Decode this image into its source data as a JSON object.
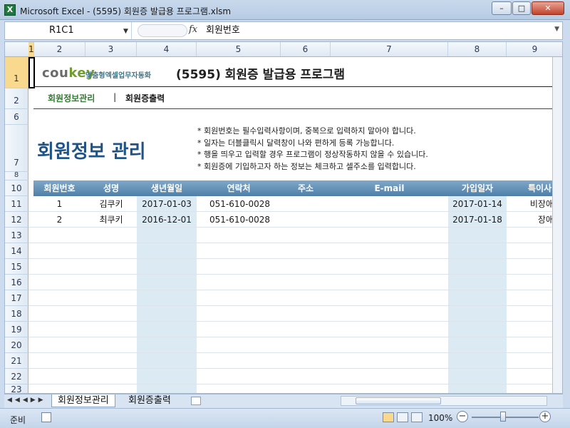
{
  "window": {
    "title": "Microsoft Excel - (5595) 회원증 발급용 프로그램.xlsm",
    "minimize": "–",
    "maximize": "□",
    "close": "✕"
  },
  "formula": {
    "namebox": "R1C1",
    "fx": "fx",
    "content": "회원번호"
  },
  "columns": [
    "1",
    "2",
    "3",
    "4",
    "5",
    "6",
    "7",
    "8",
    "9"
  ],
  "rows": [
    "1",
    "2",
    "6",
    "7",
    "8",
    "10",
    "11",
    "12",
    "13",
    "14",
    "15",
    "16",
    "17",
    "18",
    "19",
    "20",
    "21",
    "22",
    "23"
  ],
  "header": {
    "logo_main": "cou",
    "logo_accent": "key",
    "logo_sub": "맞춤형엑셀업무자동화",
    "program_title": "(5595) 회원증 발급용 프로그램"
  },
  "nav": {
    "active": "회원정보관리",
    "separator": "|",
    "other": "회원증출력"
  },
  "page_title": "회원정보 관리",
  "notes": [
    "* 회원번호는 필수입력사항이며, 중복으로 입력하지 말아야 합니다.",
    "* 일자는 더블클릭시 달력창이 나와 편하게 등록 가능합니다.",
    "* 행을 띄우고 입력할 경우 프로그램이 정상작동하지 않을 수 있습니다.",
    "* 회원증에 기입하고자 하는 정보는 체크하고 셀주소를 입력합니다."
  ],
  "table": {
    "headers": [
      "회원번호",
      "성명",
      "생년월일",
      "연락처",
      "주소",
      "E-mail",
      "가입일자",
      "특이사"
    ],
    "rows": [
      [
        "1",
        "김쿠키",
        "2017-01-03",
        "051-610-0028",
        "",
        "",
        "2017-01-14",
        "비장애"
      ],
      [
        "2",
        "최쿠키",
        "2016-12-01",
        "051-610-0028",
        "",
        "",
        "2017-01-18",
        "장애"
      ]
    ]
  },
  "tabs": {
    "sheet1": "회원정보관리",
    "sheet2": "회원증출력"
  },
  "status": {
    "ready": "준비",
    "zoom": "100%",
    "minus": "−",
    "plus": "+"
  }
}
